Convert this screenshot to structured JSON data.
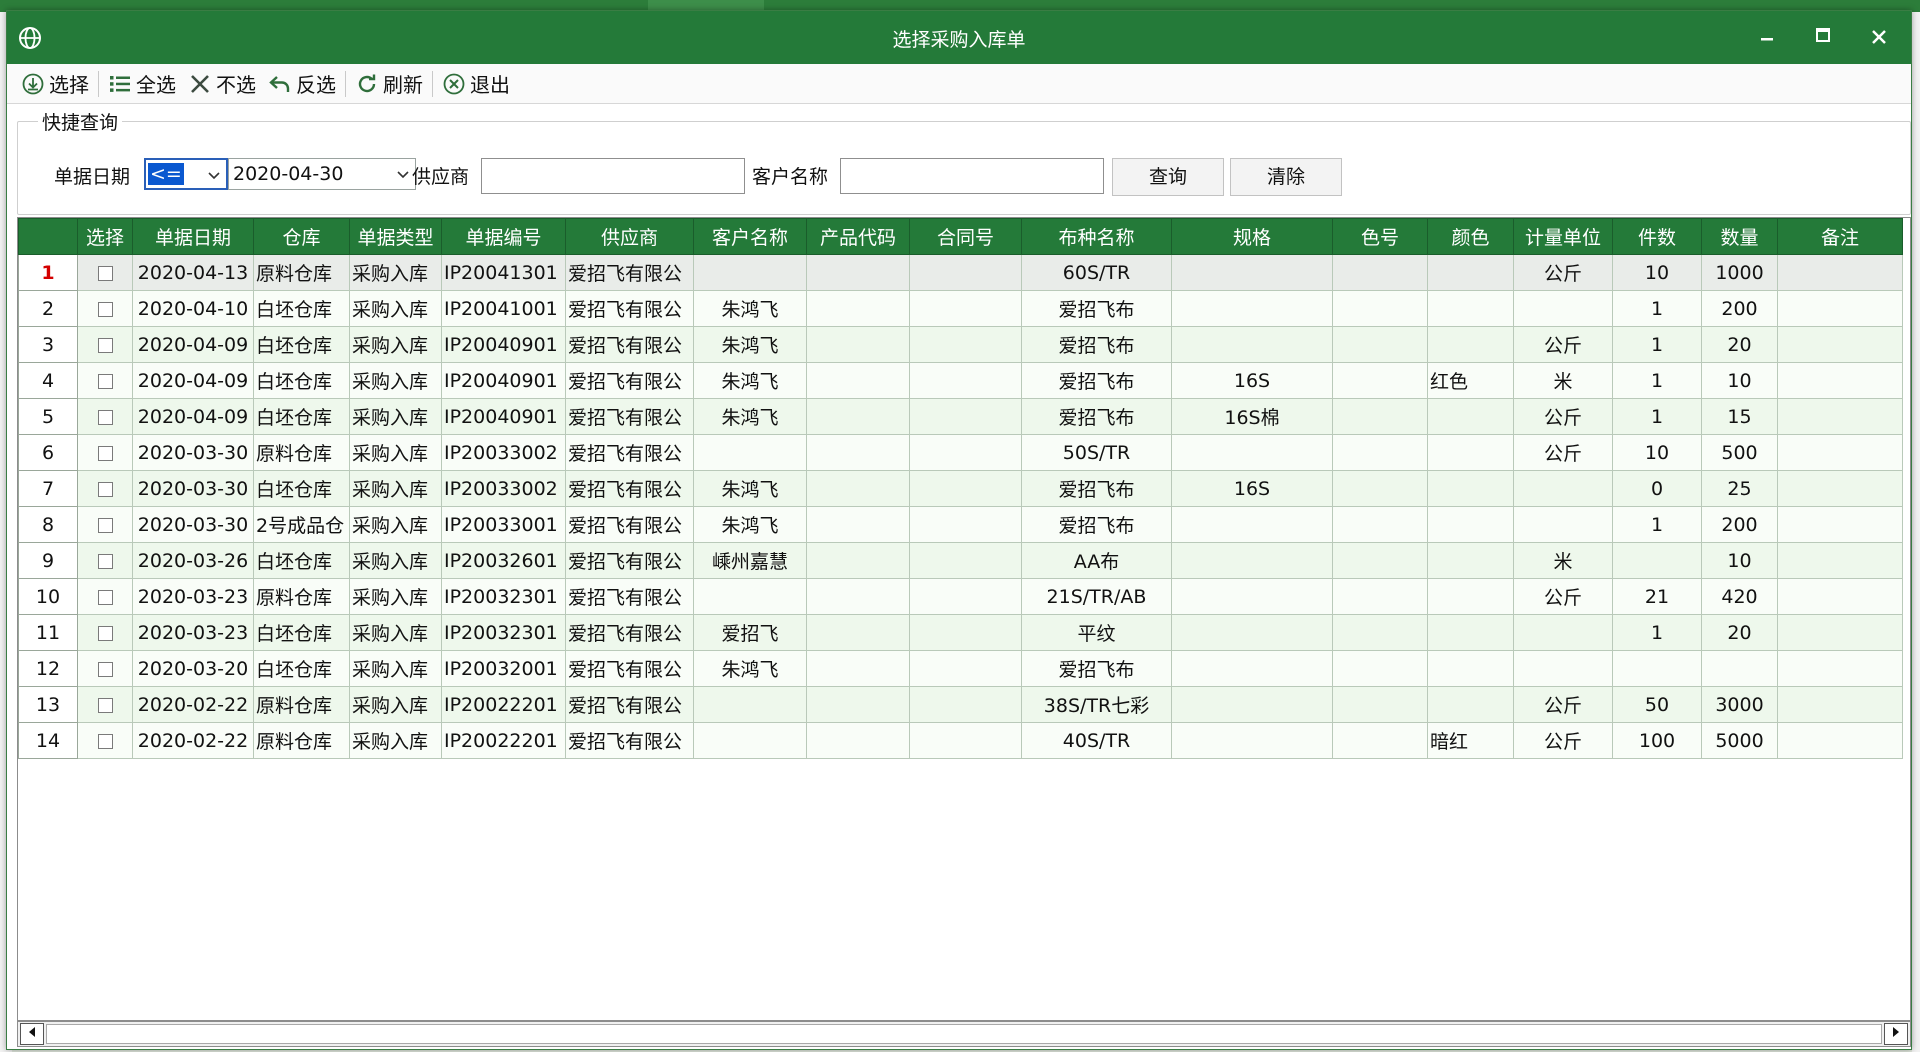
{
  "window": {
    "title": "选择采购入库单"
  },
  "toolbar": {
    "select": "选择",
    "select_all": "全选",
    "select_none": "不选",
    "invert": "反选",
    "refresh": "刷新",
    "exit": "退出"
  },
  "query": {
    "legend": "快捷查询",
    "date_label": "单据日期",
    "operator": "<=",
    "date_value": "2020-04-30",
    "supplier_label": "供应商",
    "supplier_value": "",
    "customer_label": "客户名称",
    "customer_value": "",
    "search_button": "查询",
    "clear_button": "清除"
  },
  "table": {
    "columns": [
      "",
      "选择",
      "单据日期",
      "仓库",
      "单据类型",
      "单据编号",
      "供应商",
      "客户名称",
      "产品代码",
      "合同号",
      "布种名称",
      "规格",
      "色号",
      "颜色",
      "计量单位",
      "件数",
      "数量",
      "备注"
    ],
    "rows": [
      {
        "no": "1",
        "date": "2020-04-13",
        "warehouse": "原料仓库",
        "type": "采购入库",
        "code": "IP20041301",
        "supplier": "爱招飞有限公",
        "customer": "",
        "product": "",
        "contract": "",
        "fabric": "60S/TR",
        "spec": "",
        "color_no": "",
        "color": "",
        "unit": "公斤",
        "pieces": "10",
        "qty": "1000",
        "remark": ""
      },
      {
        "no": "2",
        "date": "2020-04-10",
        "warehouse": "白坯仓库",
        "type": "采购入库",
        "code": "IP20041001",
        "supplier": "爱招飞有限公",
        "customer": "朱鸿飞",
        "product": "",
        "contract": "",
        "fabric": "爱招飞布",
        "spec": "",
        "color_no": "",
        "color": "",
        "unit": "",
        "pieces": "1",
        "qty": "200",
        "remark": ""
      },
      {
        "no": "3",
        "date": "2020-04-09",
        "warehouse": "白坯仓库",
        "type": "采购入库",
        "code": "IP20040901",
        "supplier": "爱招飞有限公",
        "customer": "朱鸿飞",
        "product": "",
        "contract": "",
        "fabric": "爱招飞布",
        "spec": "",
        "color_no": "",
        "color": "",
        "unit": "公斤",
        "pieces": "1",
        "qty": "20",
        "remark": ""
      },
      {
        "no": "4",
        "date": "2020-04-09",
        "warehouse": "白坯仓库",
        "type": "采购入库",
        "code": "IP20040901",
        "supplier": "爱招飞有限公",
        "customer": "朱鸿飞",
        "product": "",
        "contract": "",
        "fabric": "爱招飞布",
        "spec": "16S",
        "color_no": "",
        "color": "红色",
        "unit": "米",
        "pieces": "1",
        "qty": "10",
        "remark": ""
      },
      {
        "no": "5",
        "date": "2020-04-09",
        "warehouse": "白坯仓库",
        "type": "采购入库",
        "code": "IP20040901",
        "supplier": "爱招飞有限公",
        "customer": "朱鸿飞",
        "product": "",
        "contract": "",
        "fabric": "爱招飞布",
        "spec": "16S棉",
        "color_no": "",
        "color": "",
        "unit": "公斤",
        "pieces": "1",
        "qty": "15",
        "remark": ""
      },
      {
        "no": "6",
        "date": "2020-03-30",
        "warehouse": "原料仓库",
        "type": "采购入库",
        "code": "IP20033002",
        "supplier": "爱招飞有限公",
        "customer": "",
        "product": "",
        "contract": "",
        "fabric": "50S/TR",
        "spec": "",
        "color_no": "",
        "color": "",
        "unit": "公斤",
        "pieces": "10",
        "qty": "500",
        "remark": ""
      },
      {
        "no": "7",
        "date": "2020-03-30",
        "warehouse": "白坯仓库",
        "type": "采购入库",
        "code": "IP20033002",
        "supplier": "爱招飞有限公",
        "customer": "朱鸿飞",
        "product": "",
        "contract": "",
        "fabric": "爱招飞布",
        "spec": "16S",
        "color_no": "",
        "color": "",
        "unit": "",
        "pieces": "0",
        "qty": "25",
        "remark": ""
      },
      {
        "no": "8",
        "date": "2020-03-30",
        "warehouse": "2号成品仓",
        "type": "采购入库",
        "code": "IP20033001",
        "supplier": "爱招飞有限公",
        "customer": "朱鸿飞",
        "product": "",
        "contract": "",
        "fabric": "爱招飞布",
        "spec": "",
        "color_no": "",
        "color": "",
        "unit": "",
        "pieces": "1",
        "qty": "200",
        "remark": ""
      },
      {
        "no": "9",
        "date": "2020-03-26",
        "warehouse": "白坯仓库",
        "type": "采购入库",
        "code": "IP20032601",
        "supplier": "爱招飞有限公",
        "customer": "嵊州嘉慧",
        "product": "",
        "contract": "",
        "fabric": "AA布",
        "spec": "",
        "color_no": "",
        "color": "",
        "unit": "米",
        "pieces": "",
        "qty": "10",
        "remark": ""
      },
      {
        "no": "10",
        "date": "2020-03-23",
        "warehouse": "原料仓库",
        "type": "采购入库",
        "code": "IP20032301",
        "supplier": "爱招飞有限公",
        "customer": "",
        "product": "",
        "contract": "",
        "fabric": "21S/TR/AB",
        "spec": "",
        "color_no": "",
        "color": "",
        "unit": "公斤",
        "pieces": "21",
        "qty": "420",
        "remark": ""
      },
      {
        "no": "11",
        "date": "2020-03-23",
        "warehouse": "白坯仓库",
        "type": "采购入库",
        "code": "IP20032301",
        "supplier": "爱招飞有限公",
        "customer": "爱招飞",
        "product": "",
        "contract": "",
        "fabric": "平纹",
        "spec": "",
        "color_no": "",
        "color": "",
        "unit": "",
        "pieces": "1",
        "qty": "20",
        "remark": ""
      },
      {
        "no": "12",
        "date": "2020-03-20",
        "warehouse": "白坯仓库",
        "type": "采购入库",
        "code": "IP20032001",
        "supplier": "爱招飞有限公",
        "customer": "朱鸿飞",
        "product": "",
        "contract": "",
        "fabric": "爱招飞布",
        "spec": "",
        "color_no": "",
        "color": "",
        "unit": "",
        "pieces": "",
        "qty": "",
        "remark": ""
      },
      {
        "no": "13",
        "date": "2020-02-22",
        "warehouse": "原料仓库",
        "type": "采购入库",
        "code": "IP20022201",
        "supplier": "爱招飞有限公",
        "customer": "",
        "product": "",
        "contract": "",
        "fabric": "38S/TR七彩",
        "spec": "",
        "color_no": "",
        "color": "",
        "unit": "公斤",
        "pieces": "50",
        "qty": "3000",
        "remark": ""
      },
      {
        "no": "14",
        "date": "2020-02-22",
        "warehouse": "原料仓库",
        "type": "采购入库",
        "code": "IP20022201",
        "supplier": "爱招飞有限公",
        "customer": "",
        "product": "",
        "contract": "",
        "fabric": "40S/TR",
        "spec": "",
        "color_no": "",
        "color": "暗红",
        "unit": "公斤",
        "pieces": "100",
        "qty": "5000",
        "remark": ""
      }
    ]
  },
  "colors": {
    "titlebar": "#247a39",
    "header": "#247a39",
    "row_odd": "#eef8ec",
    "row_even": "#f9fdf8",
    "current_row_num": "#d40000"
  },
  "icons": {
    "app": "globe-icon",
    "minimize": "minimize-icon",
    "maximize": "maximize-icon",
    "close": "close-icon",
    "select": "download-circle-icon",
    "select_all": "list-icon",
    "select_none": "x-mark-icon",
    "invert": "undo-arrow-icon",
    "refresh": "refresh-icon",
    "exit": "close-circle-icon"
  }
}
